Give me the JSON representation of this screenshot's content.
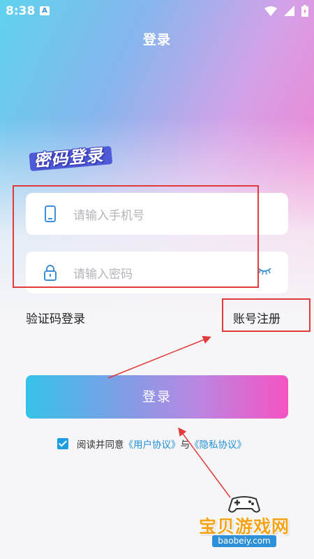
{
  "status_bar": {
    "time": "8:38",
    "notification_letter": "A"
  },
  "header": {
    "title": "登录"
  },
  "logo_text": "密码登录",
  "form": {
    "phone_placeholder": "请输入手机号",
    "password_placeholder": "请输入密码"
  },
  "links": {
    "sms_login": "验证码登录",
    "register": "账号注册"
  },
  "login_button": "登录",
  "agreement": {
    "checked": true,
    "prefix": "阅读并同意",
    "user_agreement": "《用户协议》",
    "and": "与",
    "privacy_policy": "《隐私协议》"
  },
  "watermark": {
    "name": "宝贝游戏网",
    "url": "baobeiy.com"
  },
  "colors": {
    "accent_blue": "#1e9ee0",
    "gradient_start": "#36c3ea",
    "gradient_end": "#f553c3",
    "annotation_red": "#e23a3a",
    "watermark_orange": "#f4a41a"
  }
}
